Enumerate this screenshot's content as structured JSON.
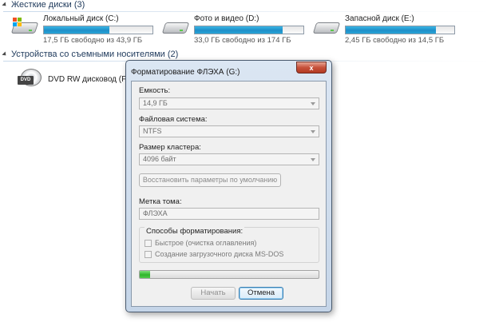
{
  "hard_disks": {
    "header": "Жесткие диски (3)",
    "drives": [
      {
        "name": "Локальный диск (C:)",
        "free_text": "17,5 ГБ свободно из 43,9 ГБ",
        "used_fraction": 0.6,
        "icon": "windows-drive-icon"
      },
      {
        "name": "Фото и видео (D:)",
        "free_text": "33,0 ГБ свободно из 174 ГБ",
        "used_fraction": 0.81,
        "icon": "hard-drive-icon"
      },
      {
        "name": "Запасной диск (E:)",
        "free_text": "2,45 ГБ свободно из 14,5 ГБ",
        "used_fraction": 0.83,
        "icon": "hard-drive-icon"
      }
    ]
  },
  "removable": {
    "header": "Устройства со съемными носителями (2)",
    "dvd": {
      "name": "DVD RW дисковод (F:)",
      "icon": "dvd-drive-icon",
      "badge": "DVD"
    }
  },
  "dialog": {
    "title": "Форматирование ФЛЭХА (G:)",
    "close_glyph": "x",
    "capacity_label": "Емкость:",
    "capacity_value": "14,9 ГБ",
    "filesystem_label": "Файловая система:",
    "filesystem_value": "NTFS",
    "cluster_label": "Размер кластера:",
    "cluster_value": "4096 байт",
    "restore_button": "Восстановить параметры по умолчанию",
    "volume_label": "Метка тома:",
    "volume_value": "ФЛЭХА",
    "format_options_title": "Способы форматирования:",
    "quick_format": "Быстрое (очистка оглавления)",
    "msdos_boot": "Создание загрузочного диска MS-DOS",
    "progress_fraction": 0.06,
    "start_button": "Начать",
    "cancel_button": "Отмена"
  },
  "colors": {
    "accent_blue": "#1f8fc8",
    "progress_green": "#2fb52a",
    "close_red": "#c7513b",
    "header_text": "#1e395b"
  }
}
